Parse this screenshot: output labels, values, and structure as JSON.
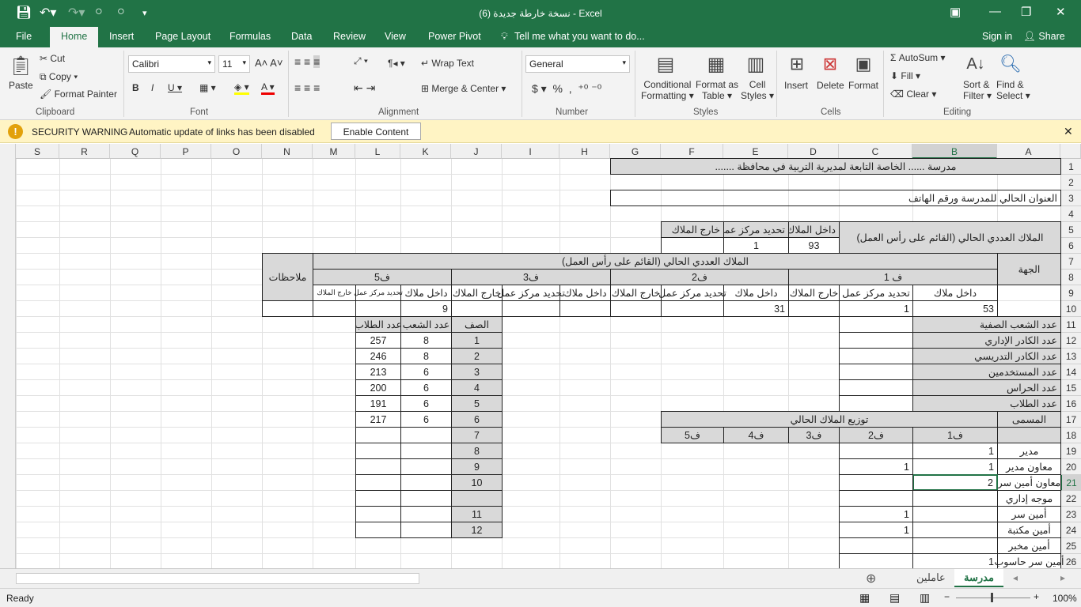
{
  "window": {
    "title": "نسخة خارطة جديدة (6) - Excel",
    "sign_in": "Sign in",
    "share": "Share"
  },
  "menu": {
    "tabs": [
      "File",
      "Home",
      "Insert",
      "Page Layout",
      "Formulas",
      "Data",
      "Review",
      "View",
      "Power Pivot"
    ],
    "tell_me": "Tell me what you want to do..."
  },
  "ribbon": {
    "clipboard": {
      "paste": "Paste",
      "cut": "Cut",
      "copy": "Copy",
      "format_painter": "Format Painter",
      "label": "Clipboard"
    },
    "font": {
      "name": "Calibri",
      "size": "11",
      "label": "Font"
    },
    "alignment": {
      "wrap": "Wrap Text",
      "merge": "Merge & Center",
      "label": "Alignment"
    },
    "number": {
      "format": "General",
      "label": "Number"
    },
    "styles": {
      "conditional": "Conditional",
      "conditional2": "Formatting",
      "format_as": "Format as",
      "format_as2": "Table",
      "cell": "Cell",
      "cell2": "Styles",
      "label": "Styles"
    },
    "cells": {
      "insert": "Insert",
      "delete": "Delete",
      "format": "Format",
      "label": "Cells"
    },
    "editing": {
      "autosum": "AutoSum",
      "fill": "Fill",
      "clear": "Clear",
      "sort": "Sort &",
      "sort2": "Filter",
      "find": "Find &",
      "find2": "Select",
      "label": "Editing"
    }
  },
  "security": {
    "title": "SECURITY WARNING",
    "message": "Automatic update of links has been disabled",
    "button": "Enable Content"
  },
  "sheet": {
    "columns": [
      "A",
      "B",
      "C",
      "D",
      "E",
      "F",
      "G",
      "H",
      "I",
      "J",
      "K",
      "L",
      "M",
      "N",
      "O",
      "P",
      "Q",
      "R",
      "S"
    ],
    "selected_cell": "B21",
    "cells": [
      {
        "ref": "A1",
        "span": [
          7,
          1
        ],
        "value": "مدرسة ...... الخاصة  التابعة لمديرية التربية في محافظة .......",
        "fill": true,
        "align": "c"
      },
      {
        "ref": "A3",
        "span": [
          7,
          1
        ],
        "value": "العنوان الحالي للمدرسة ورقم الهاتف"
      },
      {
        "ref": "A5",
        "span": [
          3,
          2
        ],
        "value": "الملاك العددي الحالي (القائم على رأس العمل)",
        "fill": true,
        "align": "c"
      },
      {
        "ref": "D5",
        "value": "داخل الملاك",
        "fill": true
      },
      {
        "ref": "E5",
        "value": "تحديد مركز عمل",
        "fill": true
      },
      {
        "ref": "F5",
        "value": "خارج الملاك",
        "fill": true
      },
      {
        "ref": "D6",
        "value": "93",
        "align": "c"
      },
      {
        "ref": "E6",
        "value": "1",
        "align": "c"
      },
      {
        "ref": "F6",
        "value": ""
      },
      {
        "ref": "A7",
        "span": [
          1,
          2
        ],
        "value": "الجهة",
        "fill": true,
        "align": "c"
      },
      {
        "ref": "B7",
        "span": [
          12,
          1
        ],
        "value": "الملاك العددي الحالي (القائم على رأس العمل)",
        "fill": true,
        "align": "c"
      },
      {
        "ref": "N7",
        "span": [
          1,
          3
        ],
        "value": "ملاحظات",
        "fill": true,
        "align": "c"
      },
      {
        "ref": "B8",
        "span": [
          3,
          1
        ],
        "value": "ف 1",
        "fill": true,
        "align": "c"
      },
      {
        "ref": "E8",
        "span": [
          3,
          1
        ],
        "value": "ف2",
        "fill": true,
        "align": "c"
      },
      {
        "ref": "H8",
        "span": [
          3,
          1
        ],
        "value": "ف3",
        "fill": true,
        "align": "c"
      },
      {
        "ref": "K8",
        "span": [
          3,
          1
        ],
        "value": "ف5",
        "fill": true,
        "align": "c"
      },
      {
        "ref": "A9",
        "span": [
          1,
          2
        ],
        "value": ""
      },
      {
        "ref": "B9",
        "value": "داخل ملاك",
        "align": "c"
      },
      {
        "ref": "C9",
        "value": "تحديد مركز عمل",
        "align": "c"
      },
      {
        "ref": "D9",
        "value": "خارج الملاك",
        "align": "c"
      },
      {
        "ref": "E9",
        "value": "داخل ملاك",
        "align": "c"
      },
      {
        "ref": "F9",
        "value": "تحديد مركز عمل",
        "align": "c"
      },
      {
        "ref": "G9",
        "value": "خارج الملاك",
        "align": "c"
      },
      {
        "ref": "H9",
        "value": "داخل ملاك",
        "align": "c"
      },
      {
        "ref": "I9",
        "value": "تحديد مركز عمل",
        "align": "c"
      },
      {
        "ref": "J9",
        "value": "خارج الملاك",
        "align": "c"
      },
      {
        "ref": "K9",
        "value": "داخل ملاك",
        "align": "c"
      },
      {
        "ref": "L9",
        "value": "تحديد مركز عمل",
        "align": "c",
        "small": true
      },
      {
        "ref": "M9",
        "value": "خارج الملاك",
        "align": "c",
        "small": true
      },
      {
        "ref": "B10",
        "value": "53",
        "align": "n"
      },
      {
        "ref": "C10",
        "value": "1",
        "align": "n"
      },
      {
        "ref": "D10",
        "value": ""
      },
      {
        "ref": "E10",
        "value": "31",
        "align": "n"
      },
      {
        "ref": "F10",
        "value": ""
      },
      {
        "ref": "G10",
        "value": ""
      },
      {
        "ref": "H10",
        "value": ""
      },
      {
        "ref": "I10",
        "value": ""
      },
      {
        "ref": "J10",
        "value": ""
      },
      {
        "ref": "K10",
        "value": "9",
        "align": "n"
      },
      {
        "ref": "L10",
        "value": ""
      },
      {
        "ref": "M10",
        "value": ""
      },
      {
        "ref": "N10",
        "value": ""
      },
      {
        "ref": "A11",
        "span": [
          2,
          1
        ],
        "value": "عدد الشعب الصفية",
        "fill": true
      },
      {
        "ref": "A12",
        "span": [
          2,
          1
        ],
        "value": "عدد الكادر الإداري",
        "fill": true
      },
      {
        "ref": "A13",
        "span": [
          2,
          1
        ],
        "value": "عدد الكادر التدريسي",
        "fill": true
      },
      {
        "ref": "A14",
        "span": [
          2,
          1
        ],
        "value": "عدد المستخدمين",
        "fill": true
      },
      {
        "ref": "A15",
        "span": [
          2,
          1
        ],
        "value": "عدد الحراس",
        "fill": true
      },
      {
        "ref": "A16",
        "span": [
          2,
          1
        ],
        "value": "عدد الطلاب",
        "fill": true
      },
      {
        "ref": "C11",
        "value": ""
      },
      {
        "ref": "C12",
        "value": ""
      },
      {
        "ref": "C13",
        "value": ""
      },
      {
        "ref": "C14",
        "value": ""
      },
      {
        "ref": "C15",
        "value": ""
      },
      {
        "ref": "C16",
        "value": ""
      },
      {
        "ref": "J11",
        "value": "الصف",
        "fill": true,
        "align": "c"
      },
      {
        "ref": "K11",
        "value": "عدد الشعب",
        "fill": true,
        "align": "c"
      },
      {
        "ref": "L11",
        "value": "عدد الطلاب",
        "fill": true,
        "align": "c"
      },
      {
        "ref": "J12",
        "value": "1",
        "fill": true,
        "align": "c"
      },
      {
        "ref": "K12",
        "value": "8",
        "align": "c"
      },
      {
        "ref": "L12",
        "value": "257",
        "align": "c"
      },
      {
        "ref": "J13",
        "value": "2",
        "fill": true,
        "align": "c"
      },
      {
        "ref": "K13",
        "value": "8",
        "align": "c"
      },
      {
        "ref": "L13",
        "value": "246",
        "align": "c"
      },
      {
        "ref": "J14",
        "value": "3",
        "fill": true,
        "align": "c"
      },
      {
        "ref": "K14",
        "value": "6",
        "align": "c"
      },
      {
        "ref": "L14",
        "value": "213",
        "align": "c"
      },
      {
        "ref": "J15",
        "value": "4",
        "fill": true,
        "align": "c"
      },
      {
        "ref": "K15",
        "value": "6",
        "align": "c"
      },
      {
        "ref": "L15",
        "value": "200",
        "align": "c"
      },
      {
        "ref": "J16",
        "value": "5",
        "fill": true,
        "align": "c"
      },
      {
        "ref": "K16",
        "value": "6",
        "align": "c"
      },
      {
        "ref": "L16",
        "value": "191",
        "align": "c"
      },
      {
        "ref": "J17",
        "value": "6",
        "fill": true,
        "align": "c"
      },
      {
        "ref": "K17",
        "value": "6",
        "align": "c"
      },
      {
        "ref": "L17",
        "value": "217",
        "align": "c"
      },
      {
        "ref": "J18",
        "value": "7",
        "fill": true,
        "align": "c"
      },
      {
        "ref": "K18",
        "value": ""
      },
      {
        "ref": "L18",
        "value": ""
      },
      {
        "ref": "J19",
        "value": "8",
        "fill": true,
        "align": "c"
      },
      {
        "ref": "K19",
        "value": ""
      },
      {
        "ref": "L19",
        "value": ""
      },
      {
        "ref": "J20",
        "value": "9",
        "fill": true,
        "align": "c"
      },
      {
        "ref": "K20",
        "value": ""
      },
      {
        "ref": "L20",
        "value": ""
      },
      {
        "ref": "J21",
        "value": "10",
        "fill": true,
        "align": "c"
      },
      {
        "ref": "K21",
        "value": ""
      },
      {
        "ref": "L21",
        "value": ""
      },
      {
        "ref": "J22",
        "value": "",
        "fill": true
      },
      {
        "ref": "K22",
        "value": ""
      },
      {
        "ref": "L22",
        "value": ""
      },
      {
        "ref": "J23",
        "value": "11",
        "fill": true,
        "align": "c"
      },
      {
        "ref": "K23",
        "value": ""
      },
      {
        "ref": "L23",
        "value": ""
      },
      {
        "ref": "J24",
        "value": "12",
        "fill": true,
        "align": "c"
      },
      {
        "ref": "K24",
        "value": ""
      },
      {
        "ref": "L24",
        "value": ""
      },
      {
        "ref": "A17",
        "value": "المسمى",
        "fill": true,
        "align": "c"
      },
      {
        "ref": "B17",
        "span": [
          5,
          1
        ],
        "value": "توزيع الملاك الحالي",
        "fill": true,
        "align": "c"
      },
      {
        "ref": "A18",
        "value": "",
        "fill": true
      },
      {
        "ref": "B18",
        "value": "ف1",
        "fill": true,
        "align": "c"
      },
      {
        "ref": "C18",
        "value": "ف2",
        "fill": true,
        "align": "c"
      },
      {
        "ref": "D18",
        "value": "ف3",
        "fill": true,
        "align": "c"
      },
      {
        "ref": "E18",
        "value": "ف4",
        "fill": true,
        "align": "c"
      },
      {
        "ref": "F18",
        "value": "ف5",
        "fill": true,
        "align": "c"
      },
      {
        "ref": "A19",
        "value": "مدير",
        "align": "c"
      },
      {
        "ref": "A20",
        "value": "معاون مدير",
        "align": "c"
      },
      {
        "ref": "A21",
        "value": "معاون أمين سر",
        "align": "c"
      },
      {
        "ref": "A22",
        "value": "موجه إداري",
        "align": "c"
      },
      {
        "ref": "A23",
        "value": "أمين سر",
        "align": "c"
      },
      {
        "ref": "A24",
        "value": "أمين مكتبة",
        "align": "c"
      },
      {
        "ref": "A25",
        "value": "أمين مخبر",
        "align": "c"
      },
      {
        "ref": "A26",
        "value": "أمين سر حاسوب",
        "align": "c"
      },
      {
        "ref": "B19",
        "value": "1",
        "align": "n"
      },
      {
        "ref": "B20",
        "value": "1",
        "align": "n"
      },
      {
        "ref": "B21",
        "value": "2",
        "align": "n"
      },
      {
        "ref": "B22",
        "value": ""
      },
      {
        "ref": "B23",
        "value": ""
      },
      {
        "ref": "B24",
        "value": ""
      },
      {
        "ref": "B25",
        "value": ""
      },
      {
        "ref": "B26",
        "value": "1",
        "align": "n"
      },
      {
        "ref": "C19",
        "value": ""
      },
      {
        "ref": "C20",
        "value": "1",
        "align": "n"
      },
      {
        "ref": "C21",
        "value": ""
      },
      {
        "ref": "C22",
        "value": ""
      },
      {
        "ref": "C23",
        "value": "1",
        "align": "n"
      },
      {
        "ref": "C24",
        "value": "1",
        "align": "n"
      },
      {
        "ref": "C25",
        "value": ""
      },
      {
        "ref": "C26",
        "value": ""
      }
    ]
  },
  "sheet_tabs": [
    "مدرسة",
    "عاملين"
  ],
  "status": {
    "ready": "Ready",
    "zoom": "100%"
  }
}
